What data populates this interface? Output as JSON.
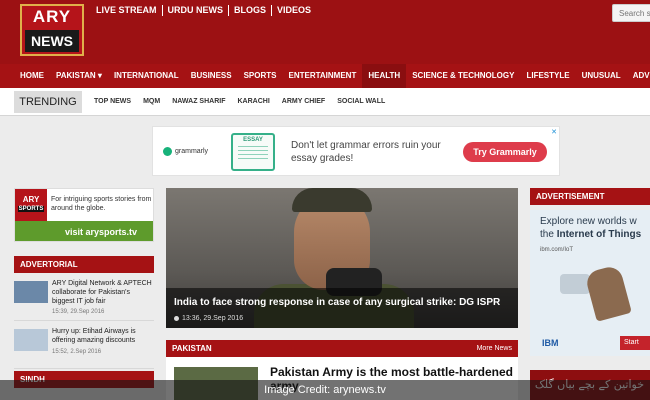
{
  "header": {
    "logo_top": "ARY",
    "logo_bottom": "NEWS",
    "top_links": [
      "LIVE STREAM",
      "URDU NEWS",
      "BLOGS",
      "VIDEOS"
    ],
    "search_placeholder": "Search s"
  },
  "nav": {
    "items": [
      "HOME",
      "PAKISTAN ▾",
      "INTERNATIONAL",
      "BUSINESS",
      "SPORTS",
      "ENTERTAINMENT",
      "HEALTH",
      "SCIENCE & TECHNOLOGY",
      "LIFESTYLE",
      "UNUSUAL",
      "ADVERTORIAL"
    ]
  },
  "trending": {
    "label": "TRENDING",
    "items": [
      "TOP NEWS",
      "MQM",
      "NAWAZ SHARIF",
      "KARACHI",
      "ARMY CHIEF",
      "SOCIAL WALL"
    ]
  },
  "ad_banner": {
    "brand": "grammarly",
    "doc_label": "ESSAY",
    "copy": "Don't let grammar errors ruin your essay grades!",
    "cta": "Try Grammarly",
    "close": "✕"
  },
  "sports_ad": {
    "logo": "ARY",
    "logo_sub": "SPORTS",
    "text": "For intriguing sports stories from around the globe.",
    "url": "visit arysports.tv"
  },
  "advertorial": {
    "heading": "ADVERTORIAL",
    "items": [
      {
        "title": "ARY Digital Network & APTECH collaborate for Pakistan's biggest IT job fair",
        "time": "15:39, 29.Sep 2016"
      },
      {
        "title": "Hurry up: Etihad Airways is offering amazing discounts",
        "time": "15:52, 2.Sep 2016"
      }
    ]
  },
  "sindh": {
    "heading": "SINDH"
  },
  "hero": {
    "title": "India to face strong response in case of any surgical strike: DG ISPR",
    "time": "13:36, 29.Sep 2016"
  },
  "pakistan": {
    "heading": "PAKISTAN",
    "more": "More News",
    "story_title": "Pakistan Army is the most battle-hardened army"
  },
  "right": {
    "heading": "ADVERTISEMENT",
    "iot_line1": "Explore new worlds w",
    "iot_line2_prefix": "the ",
    "iot_line2_bold": "Internet of Things",
    "iot_url": "ibm.com/IoT",
    "iot_brand": "IBM",
    "iot_cta": "Start",
    "urdu_text": "خواتین کے بچے بیاں گلک کریں"
  },
  "credit": "Image Credit: arynews.tv"
}
